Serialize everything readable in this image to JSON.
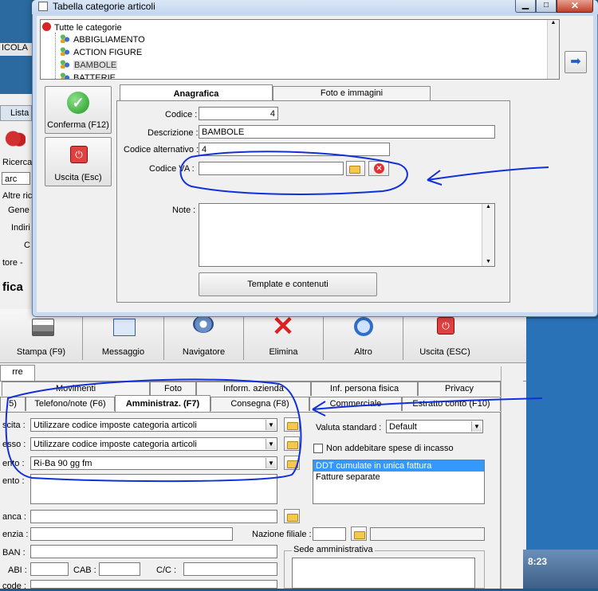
{
  "dialog": {
    "title": "Tabella categorie articoli",
    "tree": {
      "root": "Tutte le categorie",
      "items": [
        "ABBIGLIAMENTO",
        "ACTION FIGURE",
        "BAMBOLE",
        "BATTERIE"
      ],
      "selected": "BAMBOLE"
    },
    "side_buttons": {
      "confirm": "Conferma (F12)",
      "exit": "Uscita (Esc)"
    },
    "tabs": [
      "Anagrafica",
      "Foto e immagini"
    ],
    "form": {
      "codice_label": "Codice :",
      "codice_value": "4",
      "descrizione_label": "Descrizione :",
      "descrizione_value": "BAMBOLE",
      "alt_label": "Codice alternativo :",
      "alt_value": "4",
      "va_label": "Codice VA :",
      "va_value": "",
      "note_label": "Note :",
      "template_button": "Template e contenuti"
    }
  },
  "desktop_left": {
    "labels": [
      "ICOLA",
      "Lista",
      "Ricerca",
      "arc",
      "Altre ric",
      "Gene",
      "Indiri",
      "C",
      "tore -",
      "fica"
    ]
  },
  "toolbar": {
    "buttons": [
      "Stampa (F9)",
      "Messaggio",
      "Navigatore",
      "Elimina",
      "Altro",
      "Uscita (ESC)"
    ]
  },
  "main_tabs": {
    "partial_tab": "rre",
    "row1": [
      "Movimenti",
      "Foto",
      "Inform. azienda",
      "Inf. persona fisica",
      "Privacy"
    ],
    "row2": [
      "5)",
      "Telefono/note (F6)",
      "Amministraz. (F7)",
      "Consegna (F8)",
      "Commerciale",
      "Estratto conto (F10)"
    ],
    "active": "Amministraz. (F7)"
  },
  "admin_form": {
    "rows": [
      {
        "label": "scita :",
        "value": "Utilizzare codice imposte categoria articoli"
      },
      {
        "label": "esso :",
        "value": "Utilizzare codice imposte categoria articoli"
      },
      {
        "label": "ento :",
        "value": "Ri-Ba 90 gg fm"
      }
    ],
    "ento2_label": "ento :",
    "valuta_label": "Valuta standard :",
    "valuta_value": "Default",
    "spese_label": "Non addebitare spese di incasso",
    "fatt_options": [
      "DDT cumulate in unica fattura",
      "Fatture separate"
    ],
    "banca_label": "anca :",
    "agenzia_label": "enzia :",
    "nazione_label": "Nazione filiale :",
    "iban_label": "BAN :",
    "abi_label": "ABI :",
    "cab_label": "CAB :",
    "cc_label": "C/C :",
    "code_label": "code :",
    "sede_label": "Sede amministrativa"
  },
  "taskbar": {
    "clock": "8:23"
  }
}
